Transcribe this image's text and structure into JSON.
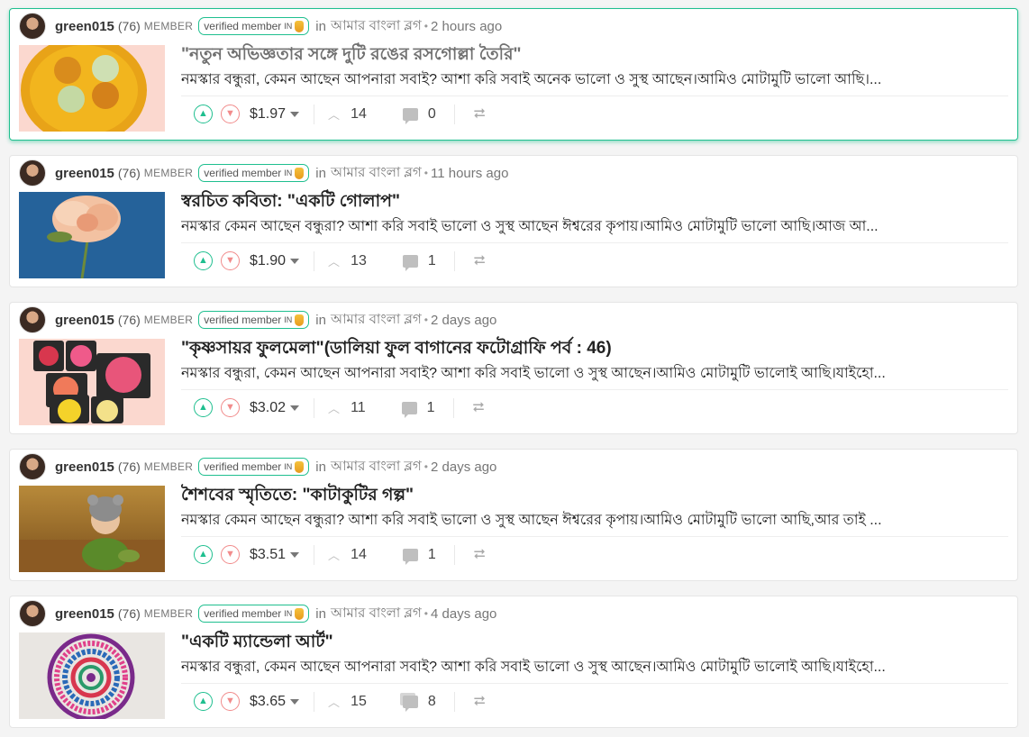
{
  "common": {
    "role": "MEMBER",
    "in_word": "in",
    "dot": "•",
    "badge_text": "verified member",
    "badge_flag": "IN",
    "up_icon": "upvote-icon",
    "down_icon": "downvote-icon",
    "comment_icon": "comment-icon",
    "reblog_icon": "reblog-icon",
    "accent_color": "#1fbf8f"
  },
  "posts": [
    {
      "author": "green015",
      "reputation": "(76)",
      "community": "আমার বাংলা ব্লগ",
      "time": "2 hours ago",
      "title": "\"নতুন অভিজ্ঞতার সঙ্গে দুটি রঙের রসগোল্লা তৈরি\"",
      "excerpt": "নমস্কার বন্ধুরা, কেমন আছেন আপনারা সবাই? আশা করি সবাই অনেক ভালো ও সুস্থ আছেন।আমিও মোটামুটি ভালো আছি।...",
      "payout": "$1.97",
      "votes": "14",
      "comments": "0",
      "selected": true
    },
    {
      "author": "green015",
      "reputation": "(76)",
      "community": "আমার বাংলা ব্লগ",
      "time": "11 hours ago",
      "title": "স্বরচিত কবিতা: \"একটি গোলাপ\"",
      "excerpt": "নমস্কার কেমন আছেন বন্ধুরা? আশা করি সবাই ভালো ও সুস্থ আছেন ঈশ্বরের কৃপায়।আমিও মোটামুটি ভালো আছি।আজ আ...",
      "payout": "$1.90",
      "votes": "13",
      "comments": "1",
      "selected": false
    },
    {
      "author": "green015",
      "reputation": "(76)",
      "community": "আমার বাংলা ব্লগ",
      "time": "2 days ago",
      "title": "\"কৃষ্ণসায়র ফুলমেলা\"(ডালিয়া ফুল বাগানের ফটোগ্রাফি পর্ব : 46)",
      "excerpt": "নমস্কার বন্ধুরা, কেমন আছেন আপনারা সবাই? আশা করি সবাই ভালো ও সুস্থ আছেন।আমিও মোটামুটি ভালোই আছি।যাইহো...",
      "payout": "$3.02",
      "votes": "11",
      "comments": "1",
      "selected": false
    },
    {
      "author": "green015",
      "reputation": "(76)",
      "community": "আমার বাংলা ব্লগ",
      "time": "2 days ago",
      "title": "শৈশবের স্মৃতিতে: \"কাটাকুটির গল্প\"",
      "excerpt": "নমস্কার কেমন আছেন বন্ধুরা? আশা করি সবাই ভালো ও সুস্থ আছেন ঈশ্বরের কৃপায়।আমিও মোটামুটি ভালো আছি,আর তাই ...",
      "payout": "$3.51",
      "votes": "14",
      "comments": "1",
      "selected": false
    },
    {
      "author": "green015",
      "reputation": "(76)",
      "community": "আমার বাংলা ব্লগ",
      "time": "4 days ago",
      "title": "\"একটি ম্যান্ডেলা আর্ট\"",
      "excerpt": "নমস্কার বন্ধুরা, কেমন আছেন আপনারা সবাই? আশা করি সবাই ভালো ও সুস্থ আছেন।আমিও মোটামুটি ভালোই আছি।যাইহো...",
      "payout": "$3.65",
      "votes": "15",
      "comments": "8",
      "selected": false
    }
  ]
}
